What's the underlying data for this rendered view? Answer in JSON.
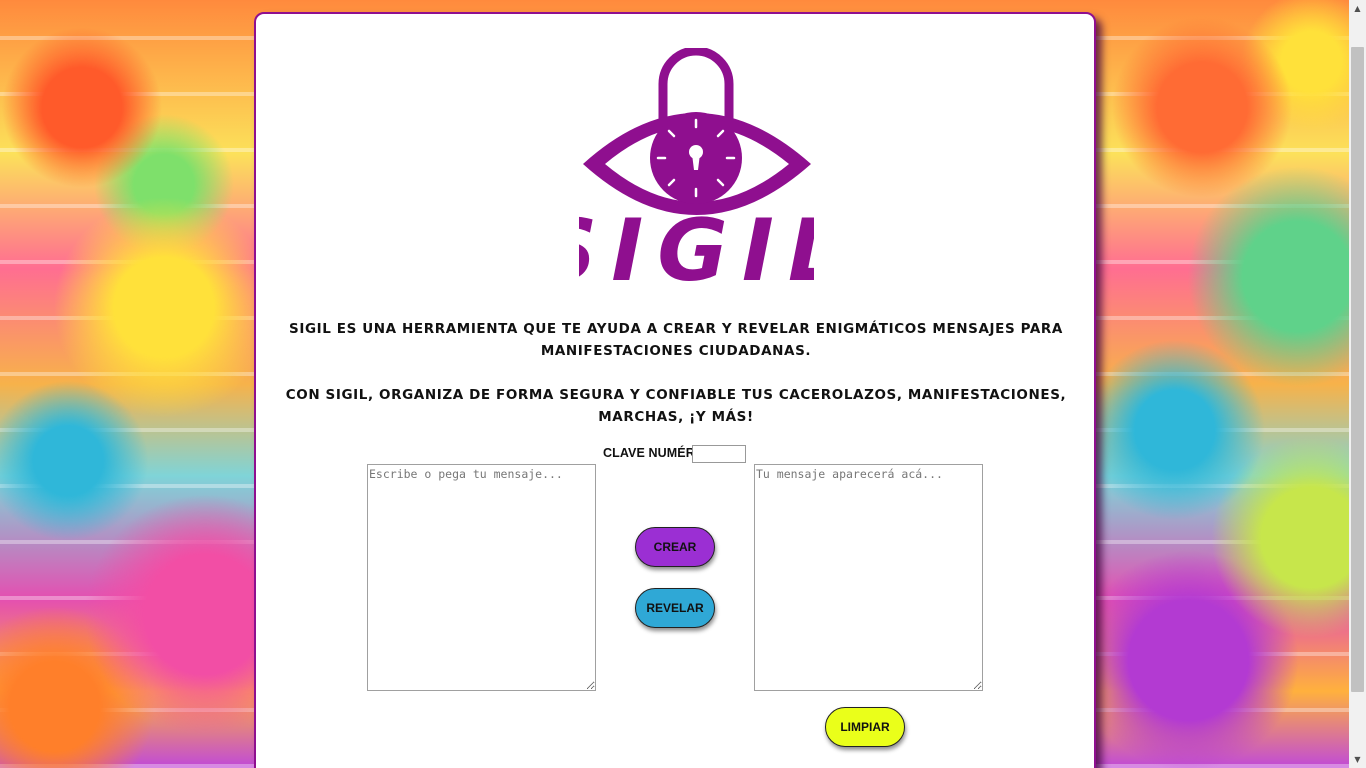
{
  "app": {
    "brand": "SIGIL",
    "colors": {
      "brand_purple": "#8f0f8f",
      "crear_button": "#9b2fd3",
      "revelar_button": "#2fa8d6",
      "limpiar_button": "#eaff1a"
    }
  },
  "intro": {
    "line1": "Sigil es una herramienta que te ayuda a crear y revelar enigmáticos mensajes para manifestaciones ciudadanas.",
    "line2": "Con Sigil, organiza de forma segura y confiable tus cacerolazos, manifestaciones, marchas, ¡y más!"
  },
  "form": {
    "key_label": "Clave numérica",
    "key_value": "",
    "input_placeholder": "Escribe o pega tu mensaje...",
    "output_placeholder": "Tu mensaje aparecerá acá...",
    "crear_label": "Crear",
    "revelar_label": "Revelar",
    "limpiar_label": "Limpiar"
  },
  "icons": {
    "logo": "eye-padlock-icon",
    "scroll_up": "scroll-up-arrow-icon",
    "scroll_down": "scroll-down-arrow-icon"
  }
}
